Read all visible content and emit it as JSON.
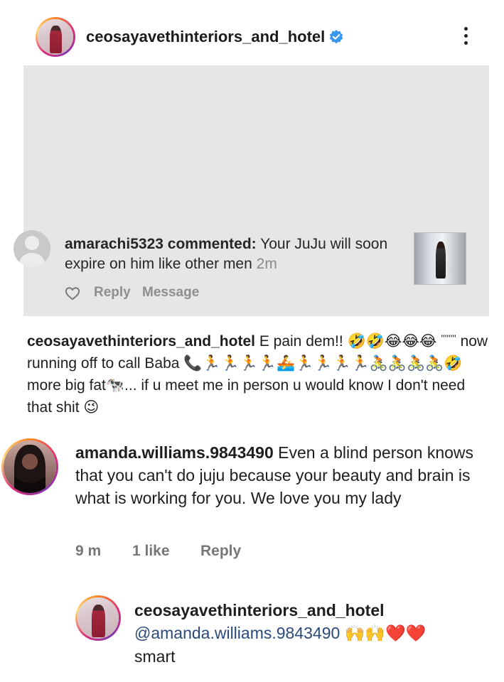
{
  "post_header": {
    "username": "ceosayavethinteriors_and_hotel",
    "verified": true,
    "avatar_icon": "profile-photo-woman-red-dress",
    "menu_icon": "more-vertical-icon"
  },
  "notification": {
    "username": "amarachi5323",
    "action": "commented:",
    "text": "Your JuJu will soon expire on him like other men",
    "time": "2m",
    "reply_label": "Reply",
    "message_label": "Message",
    "like_icon": "heart-outline-icon"
  },
  "caption": {
    "username": "ceosayavethinteriors_and_hotel",
    "text_part1": "E pain dem!!",
    "emojis1": "🤣🤣😂😂😂",
    "quote_marks": "''''''''",
    "text_part2": "now running off to call Baba",
    "emojis2": "📞🏃🏃🏃🏃🚣🏃🏃🏃🏃🚴🚴🚴🚴🤣",
    "text_part3": "more big fat",
    "emojis3": "🐄",
    "text_part4": "... if u meet me in person u would know I don't need that shit",
    "emojis4": "😉"
  },
  "comments": [
    {
      "username": "amanda.williams.9843490",
      "text": "Even a blind person knows that you can't do juju because your beauty and brain is what is working for you. We love you my lady",
      "time": "9 m",
      "likes": "1 like",
      "reply_label": "Reply"
    }
  ],
  "reply": {
    "username": "ceosayavethinteriors_and_hotel",
    "mention": "@amanda.williams.9843490",
    "emojis": "🙌🙌❤️❤️",
    "text": "smart"
  },
  "colors": {
    "verified_blue": "#3897f0",
    "meta_grey": "#8e8e8e",
    "post_bg": "#e6e6e6",
    "mention_blue": "#2a4a7a"
  }
}
